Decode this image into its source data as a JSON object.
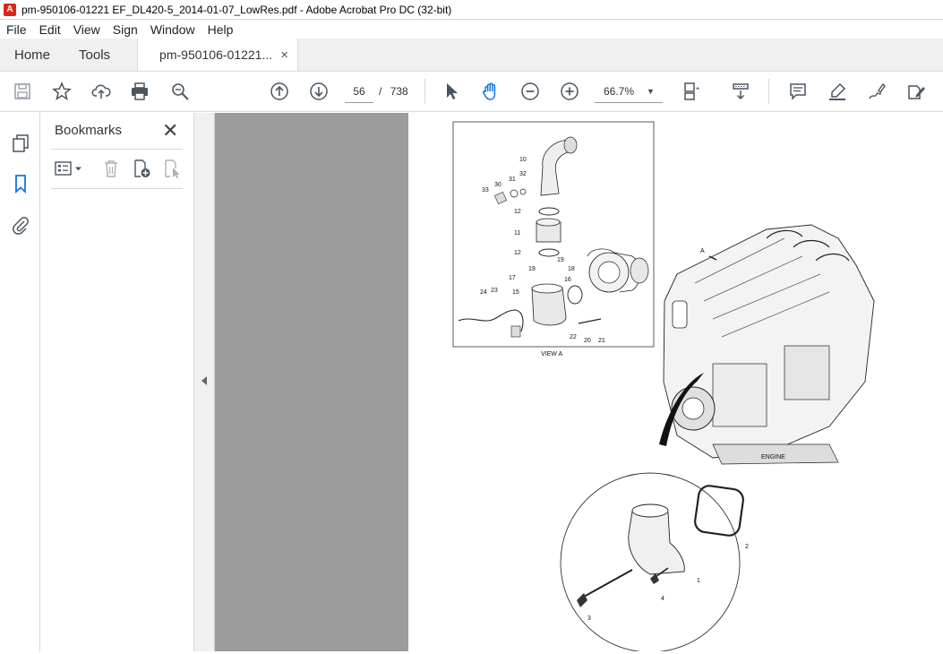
{
  "window": {
    "title": "pm-950106-01221 EF_DL420-5_2014-01-07_LowRes.pdf - Adobe Acrobat Pro DC (32-bit)",
    "logo": "acrobat-pdf-icon"
  },
  "menu": {
    "items": [
      "File",
      "Edit",
      "View",
      "Sign",
      "Window",
      "Help"
    ]
  },
  "tabs": {
    "home": "Home",
    "tools": "Tools",
    "document": "pm-950106-01221...",
    "close": "×"
  },
  "toolbar": {
    "page_current": "56",
    "page_separator": "/",
    "page_total": "738",
    "zoom": "66.7%",
    "icons": [
      "save-icon",
      "bookmark-star-icon",
      "upload-cloud-icon",
      "print-icon",
      "zoom-search-icon",
      "page-up-icon",
      "page-down-icon",
      "select-cursor-icon",
      "hand-tool-icon",
      "zoom-out-icon",
      "zoom-in-icon",
      "page-fit-icon",
      "scroll-mode-icon",
      "comment-icon",
      "highlight-icon",
      "sign-icon",
      "edit-pdf-icon"
    ]
  },
  "sidebar": {
    "icons": [
      "pages-thumbnail-icon",
      "bookmark-panel-icon",
      "attachment-icon"
    ]
  },
  "bookmarks": {
    "title": "Bookmarks",
    "close": "✕",
    "tools": [
      "options-menu-icon",
      "delete-bookmark-icon",
      "new-bookmark-icon",
      "bookmark-from-selection-icon"
    ]
  },
  "drawing": {
    "view_caption": "VIEW  A",
    "engine_caption": "ENGINE",
    "arrow_label": "A",
    "callouts_view": [
      "10",
      "33",
      "30",
      "31",
      "32",
      "12",
      "11",
      "12",
      "19",
      "18",
      "16",
      "17",
      "19",
      "24",
      "23",
      "15",
      "22",
      "20",
      "21"
    ],
    "callouts_detail": [
      "2",
      "1",
      "4",
      "3"
    ]
  }
}
